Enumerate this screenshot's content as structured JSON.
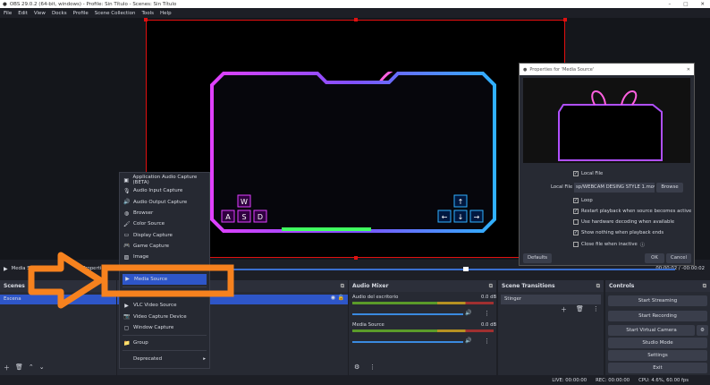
{
  "window": {
    "title": "OBS 29.0.2 (64-bit, windows) - Profile: Sin Título - Scenes: Sin Título"
  },
  "menubar": [
    "File",
    "Edit",
    "View",
    "Docks",
    "Profile",
    "Scene Collection",
    "Tools",
    "Help"
  ],
  "preview": {
    "keys_left": [
      "W",
      "A",
      "S",
      "D"
    ]
  },
  "transport": {
    "source": "Media Source",
    "properties": "Properties",
    "time": "00:00:02 / -00:00:02",
    "progress": 0.55
  },
  "context_menu": {
    "items": [
      "Application Audio Capture (BETA)",
      "Audio Input Capture",
      "Audio Output Capture",
      "Browser",
      "Color Source",
      "Display Capture",
      "Game Capture",
      "Image",
      "Image Slide Show",
      "Media Source",
      "Text (GDI+)",
      "VLC Video Source",
      "Video Capture Device",
      "Window Capture",
      "Group",
      "Deprecated"
    ],
    "selected": "Media Source"
  },
  "properties": {
    "title": "Properties for 'Media Source'",
    "local_file_check": "Local File",
    "local_file_label": "Local File",
    "local_file_value": "sp/WEBCAM DESING STYLE 1.mov",
    "browse": "Browse",
    "options": [
      {
        "label": "Loop",
        "checked": true
      },
      {
        "label": "Restart playback when source becomes active",
        "checked": true
      },
      {
        "label": "Use hardware decoding when available",
        "checked": false
      },
      {
        "label": "Show nothing when playback ends",
        "checked": true
      },
      {
        "label": "Close file when inactive",
        "checked": false
      }
    ],
    "defaults": "Defaults",
    "ok": "OK",
    "cancel": "Cancel"
  },
  "scenes": {
    "title": "Scenes",
    "items": [
      "Escena"
    ]
  },
  "audio_mixer": {
    "title": "Audio Mixer",
    "channels": [
      {
        "name": "Audio del escritorio",
        "db": "0.0 dB"
      },
      {
        "name": "Media Source",
        "db": "0.0 dB"
      }
    ]
  },
  "transitions": {
    "title": "Scene Transitions",
    "selected": "Stinger"
  },
  "controls": {
    "title": "Controls",
    "buttons": [
      "Start Streaming",
      "Start Recording",
      "Start Virtual Camera",
      "Studio Mode",
      "Settings",
      "Exit"
    ]
  },
  "status": {
    "live": "LIVE: 00:00:00",
    "rec": "REC: 00:00:00",
    "cpu": "CPU: 4.6%, 60.00 fps"
  },
  "colors": {
    "accent": "#2e56c8",
    "annotation": "#f7821e",
    "bbox": "#e01010"
  }
}
